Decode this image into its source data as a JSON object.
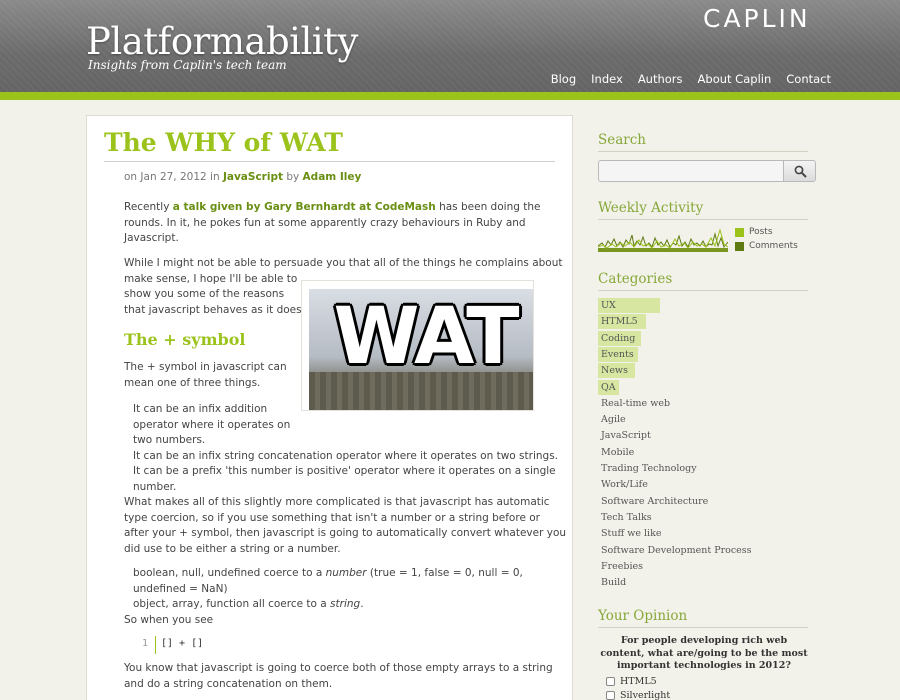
{
  "header": {
    "site_title": "Platformability",
    "tagline": "Insights from Caplin's tech team",
    "brand": "CAPLIN",
    "nav": [
      "Blog",
      "Index",
      "Authors",
      "About Caplin",
      "Contact"
    ]
  },
  "post": {
    "title": "The WHY of WAT",
    "meta": {
      "prefix": "on Jan 27, 2012 in ",
      "category": "JavaScript",
      "by": " by ",
      "author": "Adam Iley"
    },
    "p1": {
      "link": "a talk given by Gary Bernhardt at CodeMash",
      "line1_pre": "Recently ",
      "line1_post": " has been doing the",
      "line2": "rounds.  In it, he pokes fun at some apparently crazy behaviours in Ruby and",
      "line3": "Javascript."
    },
    "p2": [
      "While I might not be able to persuade you that all of the things he complains about",
      "make sense, I hope I'll be able to",
      "show you some of the reasons",
      "that javascript behaves as it does."
    ],
    "image_text": "WAT",
    "subheading": "The + symbol",
    "p3": [
      "The + symbol in javascript can",
      "mean one of three things."
    ],
    "list": [
      "It can be an infix addition",
      "operator where it operates on",
      "two numbers.",
      "It can be an infix string concatenation operator where it operates on two strings.",
      "It can be a prefix 'this number is positive' operator where it operates on a single",
      "number."
    ],
    "p4": [
      "What makes all of this slightly more complicated is that javascript has automatic",
      "type coercion, so if you use something that isn't a number or a string before or",
      "after your + symbol, then javascript is going to automatically convert whatever you",
      "did use to be either a string or a number."
    ],
    "coerce": {
      "l1_pre": "boolean, null, undefined coerce to a ",
      "l1_em": "number",
      "l1_post": " (true = 1, false = 0, null = 0,",
      "l2": "undefined = NaN)",
      "l3_pre": "object, array, function all coerce to a ",
      "l3_em": "string",
      "l3_post": "."
    },
    "when_you_see": "So when you see",
    "code": {
      "line_no": "1",
      "text": "[] + []"
    },
    "p5": [
      "You know that javascript is going to coerce both of those empty arrays to a string",
      "and do a string concatenation on them."
    ]
  },
  "sidebar": {
    "search": {
      "heading": "Search",
      "placeholder": ""
    },
    "activity": {
      "heading": "Weekly Activity",
      "legend": [
        "Posts",
        "Comments"
      ],
      "colors": {
        "posts": "#9bc31c",
        "comments": "#5e7a12"
      }
    },
    "categories": {
      "heading": "Categories",
      "items": [
        {
          "label": "UX",
          "weight": 1.0
        },
        {
          "label": "HTML5",
          "weight": 0.78
        },
        {
          "label": "Coding",
          "weight": 0.7
        },
        {
          "label": "Events",
          "weight": 0.64
        },
        {
          "label": "News",
          "weight": 0.6
        },
        {
          "label": "QA",
          "weight": 0.34
        },
        {
          "label": "Real-time web",
          "weight": 0.0
        },
        {
          "label": "Agile",
          "weight": 0.0
        },
        {
          "label": "JavaScript",
          "weight": 0.0
        },
        {
          "label": "Mobile",
          "weight": 0.0
        },
        {
          "label": "Trading Technology",
          "weight": 0.0
        },
        {
          "label": "Work/Life",
          "weight": 0.0
        },
        {
          "label": "Software Architecture",
          "weight": 0.0
        },
        {
          "label": "Tech Talks",
          "weight": 0.0
        },
        {
          "label": "Stuff we like",
          "weight": 0.0
        },
        {
          "label": "Software Development Process",
          "weight": 0.0
        },
        {
          "label": "Freebies",
          "weight": 0.0
        },
        {
          "label": "Build",
          "weight": 0.0
        }
      ]
    },
    "poll": {
      "heading": "Your Opinion",
      "question": "For people developing rich web content, what are/going to be the most important technologies in 2012?",
      "options": [
        "HTML5",
        "Silverlight"
      ]
    }
  },
  "colors": {
    "accent": "#9bc31c",
    "header_gray": "#6b6b6b",
    "page_bg": "#f3f2ea"
  }
}
